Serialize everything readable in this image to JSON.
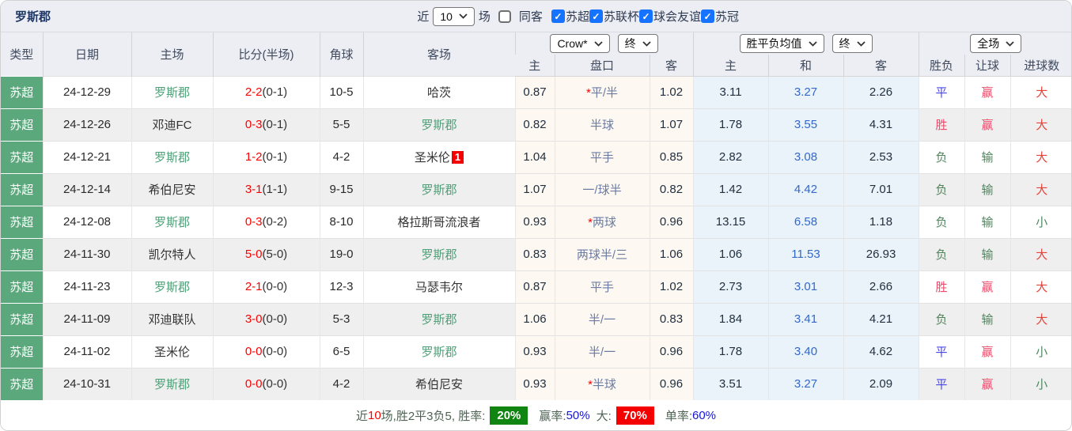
{
  "panel_title": "罗斯郡",
  "topbar": {
    "recent_label": "近",
    "recent_value": "10",
    "games_label": "场",
    "same_away_label": "同客",
    "same_away_checked": false,
    "check_glyph": "✓",
    "leagues": [
      {
        "label": "苏超",
        "checked": true
      },
      {
        "label": "苏联杯",
        "checked": true
      },
      {
        "label": "球会友谊",
        "checked": true
      },
      {
        "label": "苏冠",
        "checked": true
      }
    ]
  },
  "table": {
    "base_headers": [
      "类型",
      "日期",
      "主场",
      "比分(半场)",
      "角球",
      "客场"
    ],
    "odds_group": {
      "bookmaker": "Crow*",
      "time": "终"
    },
    "avg_group": {
      "name": "胜平负均值",
      "time": "终"
    },
    "result_group": {
      "scope": "全场"
    },
    "sub_headers": [
      "主",
      "盘口",
      "客",
      "主",
      "和",
      "客",
      "胜负",
      "让球",
      "进球数"
    ],
    "rows": [
      {
        "league": "苏超",
        "date": "24-12-29",
        "home": "罗斯郡",
        "home_is_self": true,
        "score": "2-2",
        "half": "(0-1)",
        "corners": "10-5",
        "away": "哈茨",
        "away_is_self": false,
        "away_badge": "",
        "home_odds": "0.87",
        "handicap": "平/半",
        "handicap_star": true,
        "away_odds": "1.02",
        "avg_home": "3.11",
        "avg_draw": "3.27",
        "avg_away": "2.26",
        "wdl": "平",
        "handicap_result": "赢",
        "goals": "大"
      },
      {
        "league": "苏超",
        "date": "24-12-26",
        "home": "邓迪FC",
        "home_is_self": false,
        "score": "0-3",
        "half": "(0-1)",
        "corners": "5-5",
        "away": "罗斯郡",
        "away_is_self": true,
        "away_badge": "",
        "home_odds": "0.82",
        "handicap": "半球",
        "handicap_star": false,
        "away_odds": "1.07",
        "avg_home": "1.78",
        "avg_draw": "3.55",
        "avg_away": "4.31",
        "wdl": "胜",
        "handicap_result": "赢",
        "goals": "大"
      },
      {
        "league": "苏超",
        "date": "24-12-21",
        "home": "罗斯郡",
        "home_is_self": true,
        "score": "1-2",
        "half": "(0-1)",
        "corners": "4-2",
        "away": "圣米伦",
        "away_is_self": false,
        "away_badge": "1",
        "home_odds": "1.04",
        "handicap": "平手",
        "handicap_star": false,
        "away_odds": "0.85",
        "avg_home": "2.82",
        "avg_draw": "3.08",
        "avg_away": "2.53",
        "wdl": "负",
        "handicap_result": "输",
        "goals": "大"
      },
      {
        "league": "苏超",
        "date": "24-12-14",
        "home": "希伯尼安",
        "home_is_self": false,
        "score": "3-1",
        "half": "(1-1)",
        "corners": "9-15",
        "away": "罗斯郡",
        "away_is_self": true,
        "away_badge": "",
        "home_odds": "1.07",
        "handicap": "一/球半",
        "handicap_star": false,
        "away_odds": "0.82",
        "avg_home": "1.42",
        "avg_draw": "4.42",
        "avg_away": "7.01",
        "wdl": "负",
        "handicap_result": "输",
        "goals": "大"
      },
      {
        "league": "苏超",
        "date": "24-12-08",
        "home": "罗斯郡",
        "home_is_self": true,
        "score": "0-3",
        "half": "(0-2)",
        "corners": "8-10",
        "away": "格拉斯哥流浪者",
        "away_is_self": false,
        "away_badge": "",
        "home_odds": "0.93",
        "handicap": "两球",
        "handicap_star": true,
        "away_odds": "0.96",
        "avg_home": "13.15",
        "avg_draw": "6.58",
        "avg_away": "1.18",
        "wdl": "负",
        "handicap_result": "输",
        "goals": "小"
      },
      {
        "league": "苏超",
        "date": "24-11-30",
        "home": "凯尔特人",
        "home_is_self": false,
        "score": "5-0",
        "half": "(5-0)",
        "corners": "19-0",
        "away": "罗斯郡",
        "away_is_self": true,
        "away_badge": "",
        "home_odds": "0.83",
        "handicap": "两球半/三",
        "handicap_star": false,
        "away_odds": "1.06",
        "avg_home": "1.06",
        "avg_draw": "11.53",
        "avg_away": "26.93",
        "wdl": "负",
        "handicap_result": "输",
        "goals": "大"
      },
      {
        "league": "苏超",
        "date": "24-11-23",
        "home": "罗斯郡",
        "home_is_self": true,
        "score": "2-1",
        "half": "(0-0)",
        "corners": "12-3",
        "away": "马瑟韦尔",
        "away_is_self": false,
        "away_badge": "",
        "home_odds": "0.87",
        "handicap": "平手",
        "handicap_star": false,
        "away_odds": "1.02",
        "avg_home": "2.73",
        "avg_draw": "3.01",
        "avg_away": "2.66",
        "wdl": "胜",
        "handicap_result": "赢",
        "goals": "大"
      },
      {
        "league": "苏超",
        "date": "24-11-09",
        "home": "邓迪联队",
        "home_is_self": false,
        "score": "3-0",
        "half": "(0-0)",
        "corners": "5-3",
        "away": "罗斯郡",
        "away_is_self": true,
        "away_badge": "",
        "home_odds": "1.06",
        "handicap": "半/一",
        "handicap_star": false,
        "away_odds": "0.83",
        "avg_home": "1.84",
        "avg_draw": "3.41",
        "avg_away": "4.21",
        "wdl": "负",
        "handicap_result": "输",
        "goals": "大"
      },
      {
        "league": "苏超",
        "date": "24-11-02",
        "home": "圣米伦",
        "home_is_self": false,
        "score": "0-0",
        "half": "(0-0)",
        "corners": "6-5",
        "away": "罗斯郡",
        "away_is_self": true,
        "away_badge": "",
        "home_odds": "0.93",
        "handicap": "半/一",
        "handicap_star": false,
        "away_odds": "0.96",
        "avg_home": "1.78",
        "avg_draw": "3.40",
        "avg_away": "4.62",
        "wdl": "平",
        "handicap_result": "赢",
        "goals": "小"
      },
      {
        "league": "苏超",
        "date": "24-10-31",
        "home": "罗斯郡",
        "home_is_self": true,
        "score": "0-0",
        "half": "(0-0)",
        "corners": "4-2",
        "away": "希伯尼安",
        "away_is_self": false,
        "away_badge": "",
        "home_odds": "0.93",
        "handicap": "半球",
        "handicap_star": true,
        "away_odds": "0.96",
        "avg_home": "3.51",
        "avg_draw": "3.27",
        "avg_away": "2.09",
        "wdl": "平",
        "handicap_result": "赢",
        "goals": "小"
      }
    ]
  },
  "footer": {
    "prefix": "近",
    "count": "10",
    "stats": "场,胜2平3负5, 胜率:",
    "win_rate": "20%",
    "label_odds": "赢率:",
    "odds_rate": "50%",
    "label_big": "大:",
    "big_rate": "70%",
    "label_single": "单率:",
    "single_rate": "60%"
  },
  "colors": {
    "type_cell_bg": "#5AA87C",
    "self_team": "#4FA078",
    "score": "#FF0000",
    "star": "#FF0000",
    "badge_bg": "#F50000",
    "avg_draw_text": "#3568C8",
    "result_map": {
      "胜": "#EF4A6B",
      "平": "#4646E8",
      "负": "#52845E",
      "赢": "#EF4A6B",
      "输": "#52845E",
      "大": "#E2453C",
      "小": "#4E8760"
    },
    "rate_win_bg": "#118511",
    "rate_big_bg": "#F50000",
    "rate_blue": "#1515DD"
  }
}
